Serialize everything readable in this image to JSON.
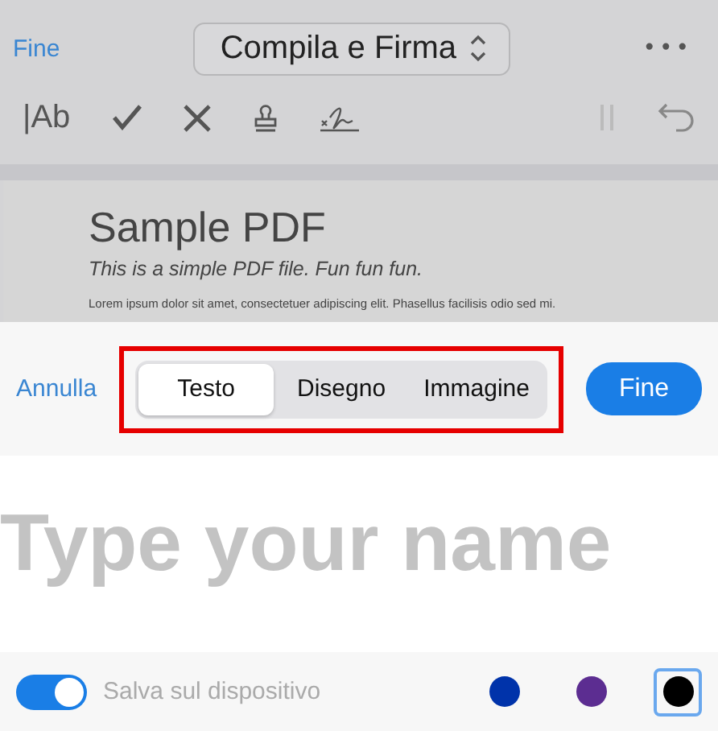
{
  "header": {
    "done": "Fine",
    "title": "Compila e Firma",
    "more": "•••"
  },
  "toolbar": {
    "text_tool": "|Ab"
  },
  "document": {
    "title": "Sample PDF",
    "subtitle": "This is a simple PDF file. Fun fun fun.",
    "body": "Lorem ipsum dolor sit amet, consectetuer adipiscing elit. Phasellus facilisis odio sed mi."
  },
  "sheet": {
    "cancel": "Annulla",
    "done": "Fine",
    "tabs": [
      {
        "label": "Testo",
        "selected": true
      },
      {
        "label": "Disegno",
        "selected": false
      },
      {
        "label": "Immagine",
        "selected": false
      }
    ],
    "signature": {
      "placeholder": "Type your name"
    },
    "save": {
      "label": "Salva sul dispositivo",
      "on": true
    },
    "colors": [
      {
        "color": "#0033aa",
        "selected": false
      },
      {
        "color": "#5c2d91",
        "selected": false
      },
      {
        "color": "#000000",
        "selected": true
      }
    ]
  }
}
